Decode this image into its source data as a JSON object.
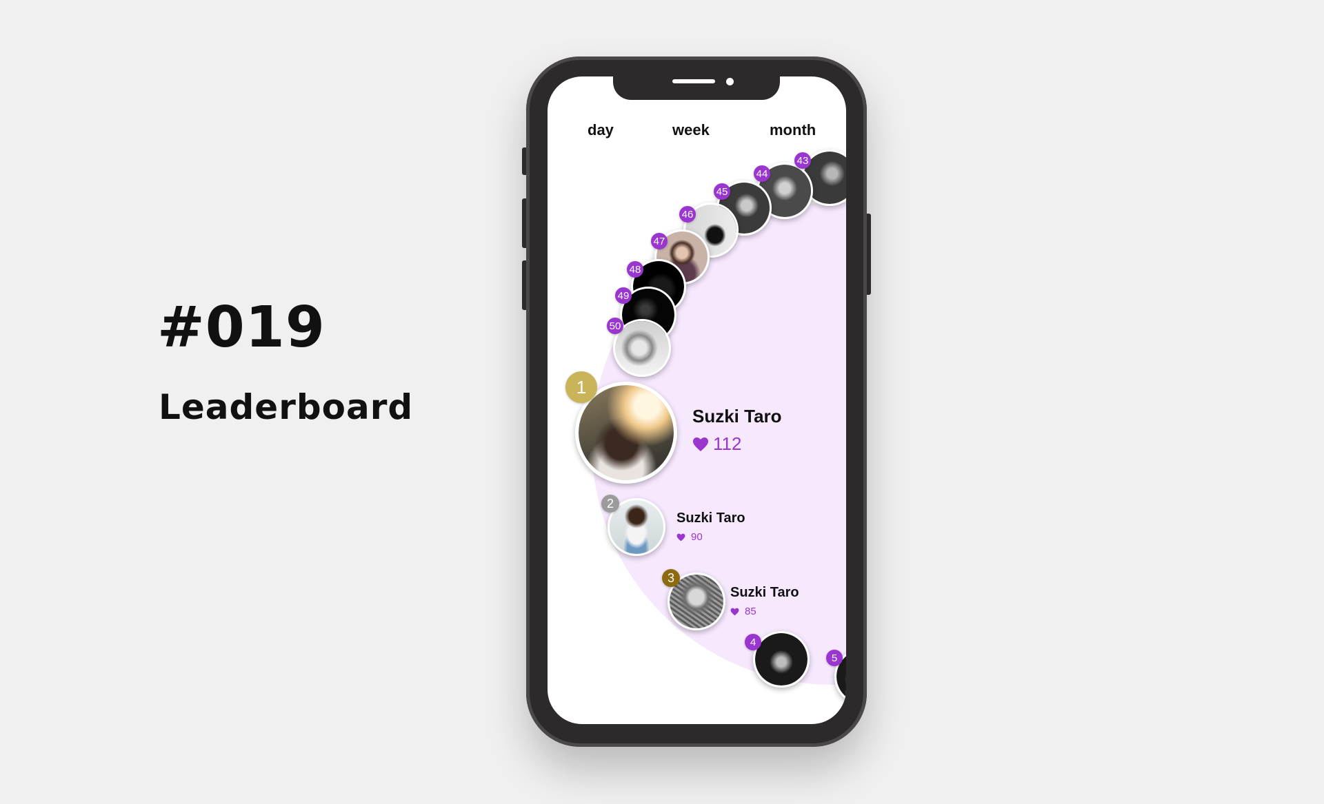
{
  "hero": {
    "number": "#019",
    "title": "Leaderboard"
  },
  "tabs": [
    {
      "label": "day",
      "active": true
    },
    {
      "label": "week",
      "active": false
    },
    {
      "label": "month",
      "active": false
    }
  ],
  "colors": {
    "accent": "#9a35cf",
    "band": "#f6e8fd",
    "gold": "#c9b45a",
    "silver": "#9b9b9b",
    "bronze": "#8c6a10"
  },
  "arc_ranks": [
    "43",
    "44",
    "45",
    "46",
    "47",
    "48",
    "49",
    "50"
  ],
  "top": [
    {
      "rank": "1",
      "name": "Suzki Taro",
      "score": "112"
    },
    {
      "rank": "2",
      "name": "Suzki Taro",
      "score": "90"
    },
    {
      "rank": "3",
      "name": "Suzki Taro",
      "score": "85"
    }
  ],
  "more_ranks": [
    "4",
    "5"
  ],
  "icons": {
    "score": "heart-icon"
  }
}
